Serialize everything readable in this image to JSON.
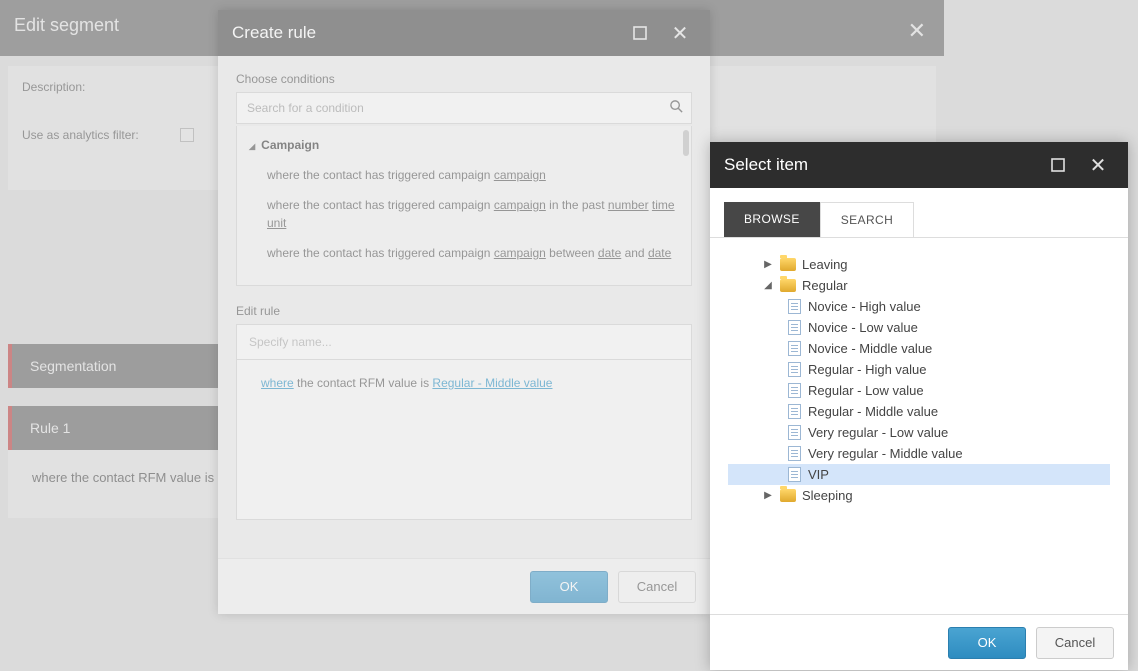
{
  "bg": {
    "title": "Edit segment",
    "description_label": "Description:",
    "filter_label": "Use as analytics filter:",
    "tabs": {
      "segmentation": "Segmentation",
      "rule1": "Rule 1"
    },
    "rule_text": "where the contact RFM value is"
  },
  "create_rule": {
    "title": "Create rule",
    "choose_label": "Choose conditions",
    "search_placeholder": "Search for a condition",
    "group": "Campaign",
    "items": {
      "a_pre": "where the contact has triggered campaign ",
      "a_u1": "campaign",
      "b_pre": "where the contact has triggered campaign ",
      "b_u1": "campaign",
      "b_mid": " in the past ",
      "b_u2": "number",
      "b_u3": "time unit",
      "c_pre": "where the contact has triggered campaign ",
      "c_u1": "campaign",
      "c_mid": " between ",
      "c_u2": "date",
      "c_mid2": " and ",
      "c_u3": "date"
    },
    "edit_label": "Edit rule",
    "name_placeholder": "Specify name...",
    "sentence": {
      "where": "where",
      "mid": " the contact RFM value is ",
      "value": "Regular - Middle value"
    },
    "ok": "OK",
    "cancel": "Cancel"
  },
  "select_item": {
    "title": "Select item",
    "tabs": {
      "browse": "BROWSE",
      "search": "SEARCH"
    },
    "folders": {
      "leaving": "Leaving",
      "regular": "Regular",
      "sleeping": "Sleeping"
    },
    "items": [
      "Novice - High value",
      "Novice - Low value",
      "Novice - Middle value",
      "Regular - High value",
      "Regular - Low value",
      "Regular - Middle value",
      "Very regular - Low value",
      "Very regular - Middle value",
      "VIP"
    ],
    "selected_index": 8,
    "ok": "OK",
    "cancel": "Cancel"
  }
}
